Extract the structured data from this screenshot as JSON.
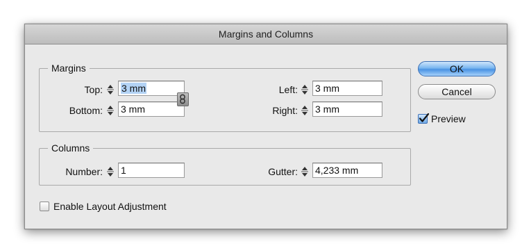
{
  "dialog": {
    "title": "Margins and Columns"
  },
  "margins": {
    "title": "Margins",
    "top": {
      "label": "Top:",
      "value": "3 mm"
    },
    "bottom": {
      "label": "Bottom:",
      "value": "3 mm"
    },
    "left": {
      "label": "Left:",
      "value": "3 mm"
    },
    "right": {
      "label": "Right:",
      "value": "3 mm"
    },
    "link_icon": "chain-link-icon"
  },
  "columns": {
    "title": "Columns",
    "number": {
      "label": "Number:",
      "value": "1"
    },
    "gutter": {
      "label": "Gutter:",
      "value": "4,233 mm"
    }
  },
  "buttons": {
    "ok": "OK",
    "cancel": "Cancel"
  },
  "preview": {
    "label": "Preview",
    "checked": true
  },
  "layout_adjustment": {
    "label": "Enable Layout Adjustment",
    "checked": false
  },
  "colors": {
    "accent": "#4a93e3",
    "selection": "#b3d3f5"
  }
}
